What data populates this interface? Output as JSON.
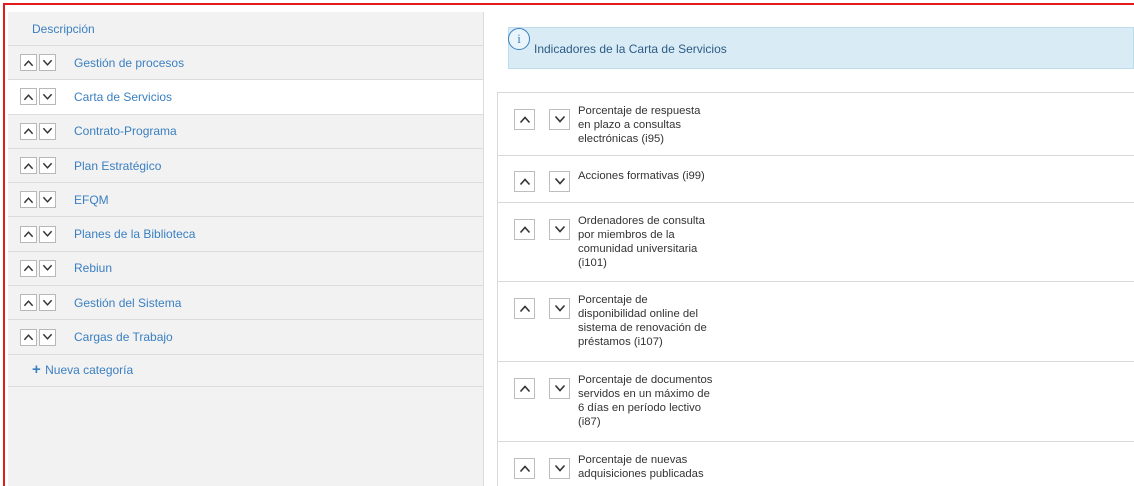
{
  "left_panel": {
    "header": "Descripción",
    "categories": [
      {
        "label": "Gestión de procesos",
        "active": false
      },
      {
        "label": "Carta de Servicios",
        "active": true
      },
      {
        "label": "Contrato-Programa",
        "active": false
      },
      {
        "label": "Plan Estratégico",
        "active": false
      },
      {
        "label": "EFQM",
        "active": false
      },
      {
        "label": "Planes de la Biblioteca",
        "active": false
      },
      {
        "label": "Rebiun",
        "active": false
      },
      {
        "label": "Gestión del Sistema",
        "active": false
      },
      {
        "label": "Cargas de Trabajo",
        "active": false
      }
    ],
    "new_category_label": "Nueva categoría"
  },
  "right_panel": {
    "info_icon": "info-icon",
    "info_text": "Indicadores de la Carta de Servicios",
    "indicators": [
      {
        "lines": [
          "Porcentaje de respuesta",
          "en plazo a consultas",
          "electrónicas (i95)"
        ]
      },
      {
        "lines": [
          "Acciones formativas (i99)"
        ]
      },
      {
        "lines": [
          "Ordenadores de consulta",
          "por miembros de la",
          "comunidad universitaria",
          "(i101)"
        ]
      },
      {
        "lines": [
          "Porcentaje de",
          "disponibilidad online del",
          "sistema de renovación de",
          "préstamos (i107)"
        ]
      },
      {
        "lines": [
          "Porcentaje de documentos",
          "servidos en un máximo de",
          "6 días en período lectivo",
          "(i87)"
        ]
      },
      {
        "lines": [
          "Porcentaje de nuevas",
          "adquisiciones publicadas"
        ]
      }
    ]
  },
  "colors": {
    "accent_red": "#e31b1b",
    "link_blue": "#3a7fc1",
    "info_bg": "#d9ecf5"
  }
}
